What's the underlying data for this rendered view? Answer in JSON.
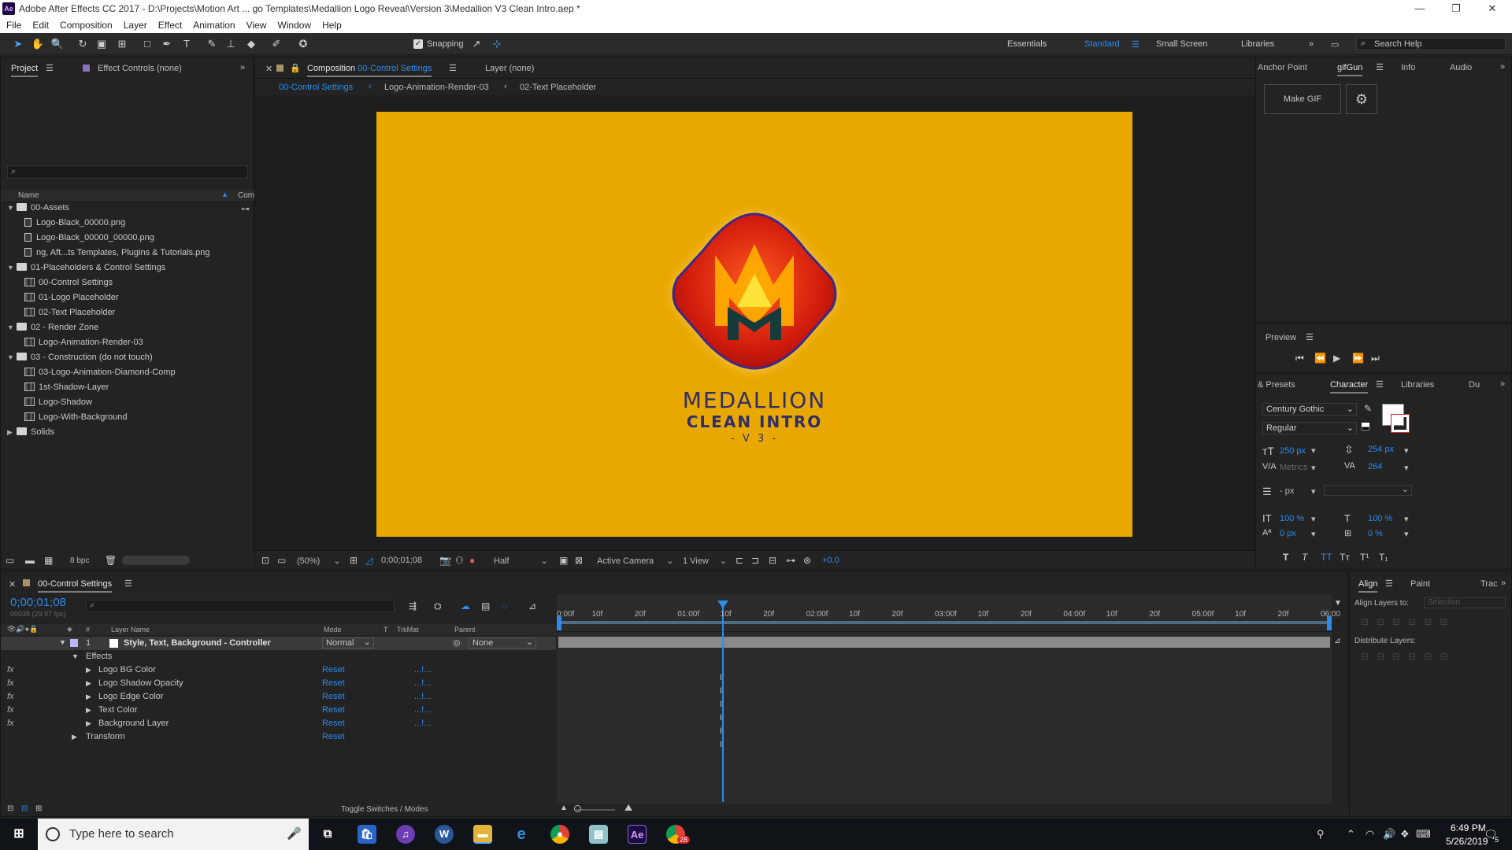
{
  "window": {
    "title": "Adobe After Effects CC 2017 - D:\\Projects\\Motion Art ... go Templates\\Medallion Logo Reveal\\Version 3\\Medallion V3 Clean Intro.aep *",
    "app_icon": "Ae",
    "min": "—",
    "max": "❐",
    "close": "✕"
  },
  "menu": [
    "File",
    "Edit",
    "Composition",
    "Layer",
    "Effect",
    "Animation",
    "View",
    "Window",
    "Help"
  ],
  "toolbar": {
    "snapping_label": "Snapping",
    "workspaces": [
      "Essentials",
      "Standard",
      "Small Screen",
      "Libraries"
    ],
    "active_workspace": "Standard",
    "search_help": "Search Help"
  },
  "project_panel": {
    "tab_project": "Project",
    "tab_effect_controls": "Effect Controls (none)",
    "search_placeholder": "",
    "col_name": "Name",
    "col_comment": "Com",
    "bpc": "8 bpc",
    "items": [
      {
        "type": "folder",
        "indent": 0,
        "label": "00-Assets"
      },
      {
        "type": "file",
        "indent": 1,
        "label": "Logo-Black_00000.png"
      },
      {
        "type": "file",
        "indent": 1,
        "label": "Logo-Black_00000_00000.png"
      },
      {
        "type": "file",
        "indent": 1,
        "label": "ng, Aft...ts Templates, Plugins & Tutorials.png"
      },
      {
        "type": "folder",
        "indent": 0,
        "label": "01-Placeholders & Control Settings"
      },
      {
        "type": "comp",
        "indent": 1,
        "label": "00-Control Settings"
      },
      {
        "type": "comp",
        "indent": 1,
        "label": "01-Logo Placeholder"
      },
      {
        "type": "comp",
        "indent": 1,
        "label": "02-Text Placeholder"
      },
      {
        "type": "folder",
        "indent": 0,
        "label": "02 - Render Zone"
      },
      {
        "type": "comp",
        "indent": 1,
        "label": "Logo-Animation-Render-03"
      },
      {
        "type": "folder",
        "indent": 0,
        "label": "03 - Construction (do not touch)"
      },
      {
        "type": "comp",
        "indent": 1,
        "label": "03-Logo-Animation-Diamond-Comp"
      },
      {
        "type": "comp",
        "indent": 1,
        "label": "1st-Shadow-Layer"
      },
      {
        "type": "comp",
        "indent": 1,
        "label": "Logo-Shadow"
      },
      {
        "type": "comp",
        "indent": 1,
        "label": "Logo-With-Background"
      },
      {
        "type": "folder-closed",
        "indent": 0,
        "label": "Solids"
      }
    ]
  },
  "composition_panel": {
    "tab_prefix": "Composition",
    "tab_comp": "00-Control Settings",
    "tab_layer": "Layer (none)",
    "breadcrumbs": [
      "00-Control Settings",
      "Logo-Animation-Render-03",
      "02-Text Placeholder"
    ],
    "canvas": {
      "background": "#E9A800",
      "title": "MEDALLION",
      "subtitle": "CLEAN INTRO",
      "version": "- V 3 -"
    },
    "footer": {
      "zoom": "(50%)",
      "timecode": "0;00;01;08",
      "resolution": "Half",
      "camera": "Active Camera",
      "views": "1 View",
      "exposure": "+0.0"
    }
  },
  "right_panels": {
    "top_tabs": [
      "Anchor Point",
      "gifGun",
      "Info",
      "Audio"
    ],
    "make_gif": "Make GIF",
    "preview_title": "Preview",
    "char_tabs": [
      "& Presets",
      "Character",
      "Libraries",
      "Du"
    ],
    "font_family": "Century Gothic",
    "font_style": "Regular",
    "font_size": "250 px",
    "leading": "254 px",
    "kerning": "Metrics",
    "tracking": "264",
    "stroke_width": "- px",
    "vscale": "100 %",
    "hscale": "100 %",
    "baseline": "0 px",
    "tsume": "0 %",
    "type_buttons": [
      "T",
      "T",
      "TT",
      "Tт",
      "T¹",
      "T₁"
    ]
  },
  "timeline": {
    "tab_title": "00-Control Settings",
    "timecode": "0;00;01;08",
    "frames": "00038 (29.97 fps)",
    "headers": {
      "num": "#",
      "layer_name": "Layer Name",
      "mode": "Mode",
      "t": "T",
      "trkmat": "TrkMat",
      "parent": "Parent"
    },
    "layer": {
      "num": "1",
      "name": "Style, Text, Background - Controller",
      "mode": "Normal",
      "parent": "None"
    },
    "effects_label": "Effects",
    "effects": [
      "Logo BG Color",
      "Logo Shadow Opacity",
      "Logo Edge Color",
      "Text Color",
      "Background Layer"
    ],
    "transform_label": "Transform",
    "reset_label": "Reset",
    "fx_label": "fx",
    "toggle_label": "Toggle Switches / Modes",
    "ruler": [
      "0:00f",
      "10f",
      "20f",
      "01:00f",
      "10f",
      "20f",
      "02:00f",
      "10f",
      "20f",
      "03:00f",
      "10f",
      "20f",
      "04:00f",
      "10f",
      "20f",
      "05:00f",
      "10f",
      "20f",
      "06:00"
    ]
  },
  "align_panel": {
    "tabs": [
      "Align",
      "Paint",
      "Trac"
    ],
    "align_layers_to": "Align Layers to:",
    "selection": "Selection",
    "distribute": "Distribute Layers:"
  },
  "taskbar": {
    "search_placeholder": "Type here to search",
    "time": "6:49 PM",
    "date": "5/26/2019",
    "notification_count": "5",
    "chrome_badge": "28"
  }
}
